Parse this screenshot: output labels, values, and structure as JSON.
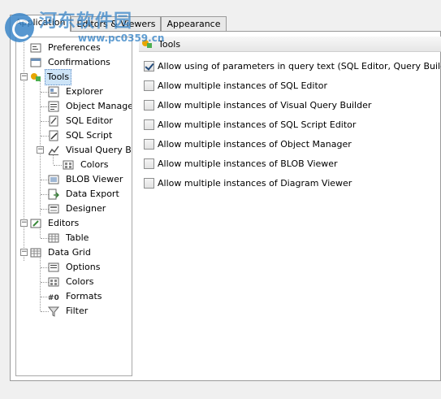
{
  "watermark": {
    "title": "河东软件园",
    "url": "www.pc0359.cn"
  },
  "tabs": [
    {
      "label": "Application",
      "active": true
    },
    {
      "label": "Editors & Viewers",
      "active": false
    },
    {
      "label": "Appearance",
      "active": false
    }
  ],
  "tree": {
    "items": [
      {
        "label": "Preferences",
        "icon": "preferences-icon"
      },
      {
        "label": "Confirmations",
        "icon": "confirmations-icon"
      },
      {
        "label": "Tools",
        "icon": "tools-icon",
        "expanded": true,
        "selected": true
      },
      {
        "label": "Explorer",
        "icon": "explorer-icon"
      },
      {
        "label": "Object Manager",
        "icon": "object-manager-icon"
      },
      {
        "label": "SQL Editor",
        "icon": "sql-editor-icon"
      },
      {
        "label": "SQL Script",
        "icon": "sql-script-icon"
      },
      {
        "label": "Visual Query Builder",
        "icon": "query-builder-icon",
        "expanded": true
      },
      {
        "label": "Colors",
        "icon": "colors-icon"
      },
      {
        "label": "BLOB Viewer",
        "icon": "blob-viewer-icon"
      },
      {
        "label": "Data Export",
        "icon": "data-export-icon"
      },
      {
        "label": "Designer",
        "icon": "designer-icon"
      },
      {
        "label": "Editors",
        "icon": "editors-icon",
        "expanded": true
      },
      {
        "label": "Table",
        "icon": "table-icon"
      },
      {
        "label": "Data Grid",
        "icon": "data-grid-icon",
        "expanded": true
      },
      {
        "label": "Options",
        "icon": "options-icon"
      },
      {
        "label": "Colors",
        "icon": "colors-icon"
      },
      {
        "label": "Formats",
        "icon": "formats-icon"
      },
      {
        "label": "Filter",
        "icon": "filter-icon"
      }
    ]
  },
  "panel": {
    "title": "Tools",
    "options": [
      {
        "label": "Allow using of parameters in query text (SQL Editor, Query Builder)",
        "checked": true
      },
      {
        "label": "Allow multiple instances of SQL Editor",
        "checked": false
      },
      {
        "label": "Allow multiple instances of Visual Query Builder",
        "checked": false
      },
      {
        "label": "Allow multiple instances of SQL Script Editor",
        "checked": false
      },
      {
        "label": "Allow multiple instances of Object Manager",
        "checked": false
      },
      {
        "label": "Allow multiple instances of BLOB Viewer",
        "checked": false
      },
      {
        "label": "Allow multiple instances of Diagram Viewer",
        "checked": false
      }
    ]
  },
  "colors": {
    "selection": "#cde4f7",
    "accent": "#3a86c8"
  }
}
